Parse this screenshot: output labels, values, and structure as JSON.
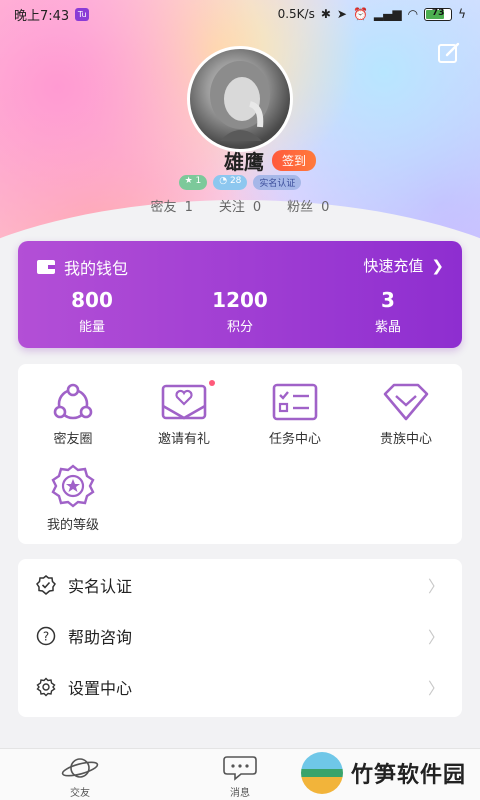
{
  "status_bar": {
    "time": "晚上7:43",
    "app_badge": "Tu",
    "network_speed": "0.5K/s",
    "battery": "73"
  },
  "profile": {
    "name": "雄鹰",
    "checkin_label": "签到",
    "badges": [
      "★ 1",
      "◔ 28",
      "实名认证"
    ],
    "stats": [
      {
        "label": "密友",
        "value": "1"
      },
      {
        "label": "关注",
        "value": "0"
      },
      {
        "label": "粉丝",
        "value": "0"
      }
    ]
  },
  "wallet": {
    "title": "我的钱包",
    "recharge": "快速充值",
    "items": [
      {
        "value": "800",
        "label": "能量"
      },
      {
        "value": "1200",
        "label": "积分"
      },
      {
        "value": "3",
        "label": "紫晶"
      }
    ]
  },
  "grid": [
    {
      "label": "密友圈",
      "icon": "circle-friends-icon"
    },
    {
      "label": "邀请有礼",
      "icon": "invite-envelope-icon"
    },
    {
      "label": "任务中心",
      "icon": "task-card-icon"
    },
    {
      "label": "贵族中心",
      "icon": "noble-diamond-icon"
    },
    {
      "label": "我的等级",
      "icon": "level-medal-icon"
    }
  ],
  "list": [
    {
      "label": "实名认证",
      "icon": "verified-badge-icon"
    },
    {
      "label": "帮助咨询",
      "icon": "help-question-icon"
    },
    {
      "label": "设置中心",
      "icon": "settings-gear-icon"
    }
  ],
  "tabs": [
    {
      "label": "交友",
      "icon": "planet-icon"
    },
    {
      "label": "消息",
      "icon": "chat-bubble-icon"
    }
  ],
  "watermark": "竹笋软件园",
  "colors": {
    "wallet_start": "#b34fd6",
    "wallet_end": "#8e2ed0",
    "icon_purple": "#a062c8",
    "checkin": "#ff5a3c"
  }
}
